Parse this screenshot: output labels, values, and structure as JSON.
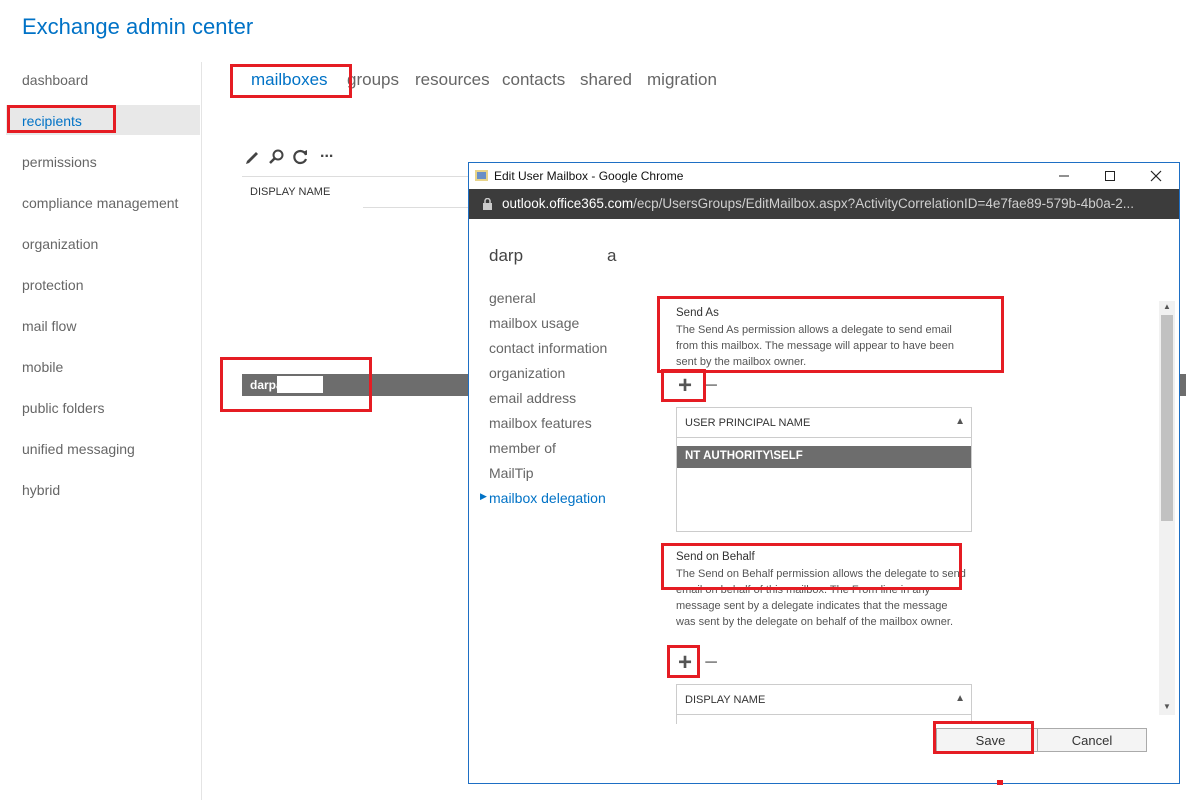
{
  "app": {
    "title": "Exchange admin center"
  },
  "left_nav": {
    "items": [
      {
        "label": "dashboard"
      },
      {
        "label": "recipients",
        "selected": true
      },
      {
        "label": "permissions"
      },
      {
        "label": "compliance management"
      },
      {
        "label": "organization"
      },
      {
        "label": "protection"
      },
      {
        "label": "mail flow"
      },
      {
        "label": "mobile"
      },
      {
        "label": "public folders"
      },
      {
        "label": "unified messaging"
      },
      {
        "label": "hybrid"
      }
    ]
  },
  "tabs": [
    {
      "label": "mailboxes",
      "active": true
    },
    {
      "label": "groups"
    },
    {
      "label": "resources"
    },
    {
      "label": "contacts"
    },
    {
      "label": "shared"
    },
    {
      "label": "migration"
    }
  ],
  "toolbar": {
    "icons": [
      "pencil-icon",
      "search-icon",
      "refresh-icon",
      "more-icon"
    ],
    "more_label": "..."
  },
  "list": {
    "column_header": "DISPLAY NAME",
    "selected_row_text": "darpa"
  },
  "popup": {
    "window_title": "Edit User Mailbox - Google Chrome",
    "address_domain": "outlook.office365.com",
    "address_path": "/ecp/UsersGroups/EditMailbox.aspx?ActivityCorrelationID=4e7fae89-579b-4b0a-2...",
    "mailbox_name_start": "darp",
    "mailbox_name_end": "a",
    "nav": [
      {
        "label": "general"
      },
      {
        "label": "mailbox usage"
      },
      {
        "label": "contact information"
      },
      {
        "label": "organization"
      },
      {
        "label": "email address"
      },
      {
        "label": "mailbox features"
      },
      {
        "label": "member of"
      },
      {
        "label": "MailTip"
      },
      {
        "label": "mailbox delegation",
        "active": true
      }
    ],
    "send_as": {
      "title": "Send As",
      "description": "The Send As permission allows a delegate to send email from this mailbox. The message will appear to have been sent by the mailbox owner.",
      "column_header": "USER PRINCIPAL NAME",
      "rows": [
        "NT AUTHORITY\\SELF"
      ]
    },
    "send_on_behalf": {
      "title": "Send on Behalf",
      "description": "The Send on Behalf permission allows the delegate to send email on behalf of this mailbox. The From line in any message sent by a delegate indicates that the message was sent by the delegate on behalf of the mailbox owner.",
      "column_header": "DISPLAY NAME"
    },
    "save_label": "Save",
    "cancel_label": "Cancel",
    "plus": "+",
    "minus": "−"
  },
  "colors": {
    "accent": "#0072c6",
    "highlight": "#e51c23",
    "selection": "#6d6d6d"
  }
}
